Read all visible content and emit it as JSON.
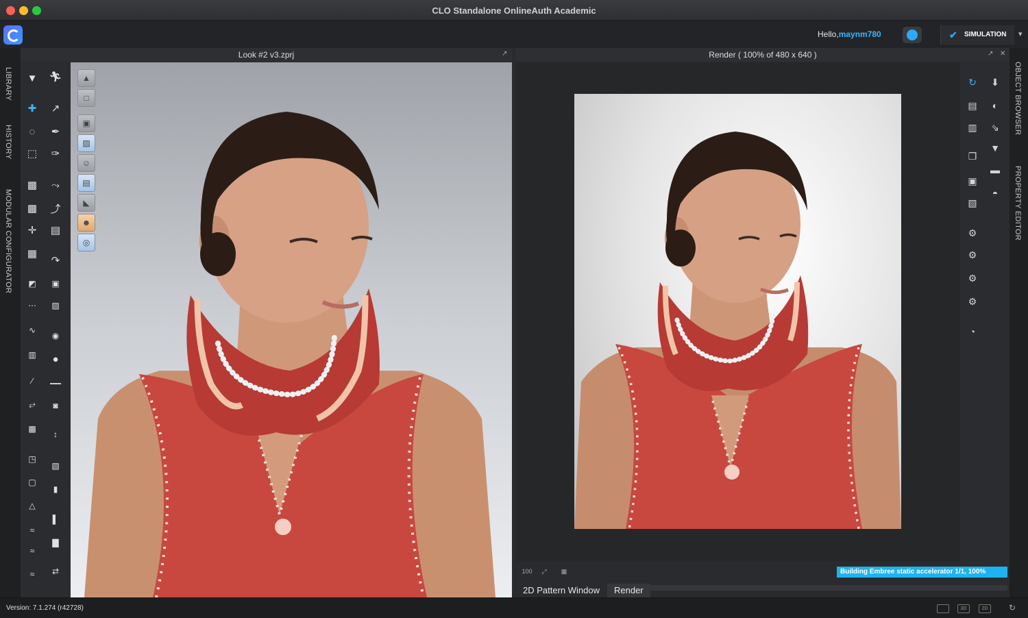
{
  "window": {
    "title": "CLO Standalone OnlineAuth Academic"
  },
  "topbar": {
    "greeting": "Hello,",
    "username": "maynm780",
    "mode_label": "SIMULATION"
  },
  "left_tabs": [
    "LIBRARY",
    "HISTORY",
    "MODULAR CONFIGURATOR"
  ],
  "right_tabs": [
    "OBJECT BROWSER",
    "PROPERTY EDITOR"
  ],
  "pane3d": {
    "title": "Look #2 v3.zprj"
  },
  "render_pane": {
    "title": "Render ( 100% of 480 x 640 )"
  },
  "render_status": {
    "message": "Building Embree static accelerator 1/1, 100%",
    "progress": 1.0
  },
  "bottom_tabs": [
    {
      "label": "2D Pattern Window",
      "selected": false
    },
    {
      "label": "Render",
      "selected": true
    }
  ],
  "statusbar": {
    "version": "Version: 7.1.274 (r42728)",
    "view_buttons": [
      "",
      "3D",
      "2D"
    ]
  },
  "colors": {
    "accent": "#2ba8ff",
    "garment": "#c8473f",
    "progress": "#1eb2f0"
  },
  "icons": {
    "left_tools": [
      "select-arrow-icon",
      "avatar-pose-icon",
      "move-gizmo-icon",
      "pin-icon",
      "lasso-icon",
      "brush-icon",
      "transform-icon",
      "edit-brush-icon",
      "garment-icon",
      "flatten-icon",
      "garment-shrink-icon",
      "pose-icon",
      "add-garment-icon",
      "hanger-icon",
      "shape-icon",
      "fold-icon",
      "pattern-icon",
      "gradient-icon",
      "sewing-icon",
      "fill-icon",
      "stitch-icon",
      "rotate-icon",
      "chart-icon",
      "button-icon",
      "needle-icon",
      "line-icon",
      "tape-icon",
      "lock-icon",
      "trim-icon",
      "zipper-icon",
      "fold-arrange-icon",
      "box-icon",
      "jacket-icon",
      "cube-icon",
      "shirt-icon",
      "bars-icon",
      "layers-icon",
      "steps-icon",
      "chevrons-icon",
      "arrows-icon"
    ]
  }
}
